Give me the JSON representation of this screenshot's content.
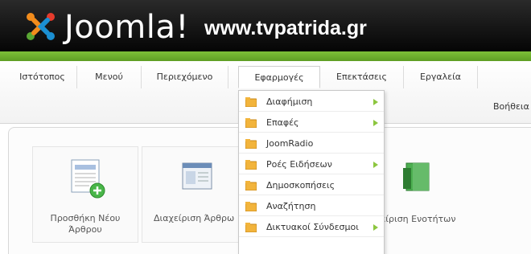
{
  "header": {
    "brand": "Joomla!",
    "site_url": "www.tvpatrida.gr"
  },
  "menu": [
    {
      "label": "Ιστότοπος"
    },
    {
      "label": "Μενού"
    },
    {
      "label": "Περιεχόμενο"
    },
    {
      "label": "Εφαρμογές"
    },
    {
      "label": "Επεκτάσεις"
    },
    {
      "label": "Εργαλεία"
    }
  ],
  "help_label": "Βοήθεια",
  "dropdown": {
    "items": [
      {
        "label": "Διαφήμιση",
        "has_submenu": true
      },
      {
        "label": "Επαφές",
        "has_submenu": true
      },
      {
        "label": "JoomRadio",
        "has_submenu": false
      },
      {
        "label": "Ροές Ειδήσεων",
        "has_submenu": true
      },
      {
        "label": "Δημοσκοπήσεις",
        "has_submenu": false
      },
      {
        "label": "Αναζήτηση",
        "has_submenu": false
      },
      {
        "label": "Δικτυακοί Σύνδεσμοι",
        "has_submenu": true
      }
    ]
  },
  "tiles": [
    {
      "label_line1": "Προσθήκη Νέου",
      "label_line2": "Άρθρου"
    },
    {
      "label_line1": "Διαχείριση Άρθρω",
      "label_line2": ""
    },
    {
      "label_line1": "ιαχείριση Ενοτήτων",
      "label_line2": ""
    }
  ],
  "colors": {
    "header_dark": "#0a0a0a",
    "accent_green": "#6aaf2c",
    "arrow_green": "#8cc63f"
  }
}
